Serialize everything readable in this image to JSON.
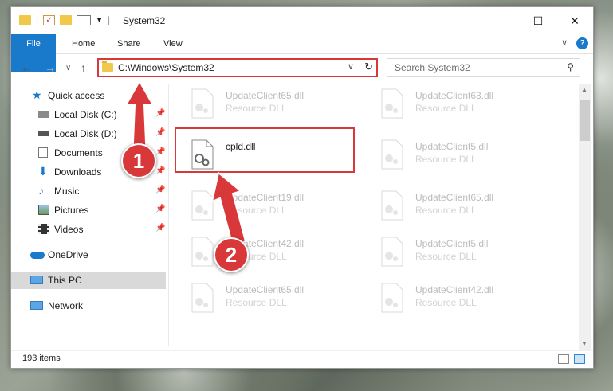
{
  "window": {
    "title": "System32",
    "controls": {
      "minimize": "—",
      "maximize": "☐",
      "close": "✕"
    }
  },
  "ribbon": {
    "tabs": [
      "File",
      "Home",
      "Share",
      "View"
    ],
    "expand": "∨",
    "help": "?"
  },
  "nav": {
    "back": "←",
    "forward": "→",
    "recent": "∨",
    "up": "↑",
    "address": "C:\\Windows\\System32",
    "dropdown": "∨",
    "refresh": "↻",
    "search_placeholder": "Search System32",
    "search_icon": "⚲"
  },
  "sidebar": {
    "pin_glyph": "📌",
    "items": [
      {
        "label": "Quick access",
        "icon": "star-icon"
      },
      {
        "label": "Local Disk (C:)",
        "icon": "drive-icon",
        "pinned": true
      },
      {
        "label": "Local Disk (D:)",
        "icon": "drive-icon",
        "pinned": true
      },
      {
        "label": "Documents",
        "icon": "documents-icon",
        "pinned": true
      },
      {
        "label": "Downloads",
        "icon": "downloads-icon",
        "pinned": true
      },
      {
        "label": "Music",
        "icon": "music-icon",
        "pinned": true
      },
      {
        "label": "Pictures",
        "icon": "pictures-icon",
        "pinned": true
      },
      {
        "label": "Videos",
        "icon": "videos-icon",
        "pinned": true
      },
      {
        "label": "OneDrive",
        "icon": "cloud-icon"
      },
      {
        "label": "This PC",
        "icon": "computer-icon",
        "selected": true
      },
      {
        "label": "Network",
        "icon": "network-icon"
      }
    ]
  },
  "files": [
    {
      "name": "UpdateClient65.dll",
      "type": "Resource DLL",
      "faded": true
    },
    {
      "name": "UpdateClient63.dll",
      "type": "Resource DLL",
      "faded": true
    },
    {
      "name": "cpld.dll",
      "type": "",
      "faded": false
    },
    {
      "name": "UpdateClient5.dll",
      "type": "Resource DLL",
      "faded": true
    },
    {
      "name": "UpdateClient19.dll",
      "type": "Resource DLL",
      "faded": true
    },
    {
      "name": "UpdateClient65.dll",
      "type": "Resource DLL",
      "faded": true
    },
    {
      "name": "UpdateClient42.dll",
      "type": "Resource DLL",
      "faded": true
    },
    {
      "name": "UpdateClient5.dll",
      "type": "Resource DLL",
      "faded": true
    },
    {
      "name": "UpdateClient65.dll",
      "type": "Resource DLL",
      "faded": true
    },
    {
      "name": "UpdateClient42.dll",
      "type": "Resource DLL",
      "faded": true
    }
  ],
  "status": {
    "count": "193 items"
  },
  "annotations": {
    "step1": "1",
    "step2": "2",
    "color": "#d9383a"
  },
  "colors": {
    "accent": "#1979ca",
    "highlight": "#d9383a"
  }
}
